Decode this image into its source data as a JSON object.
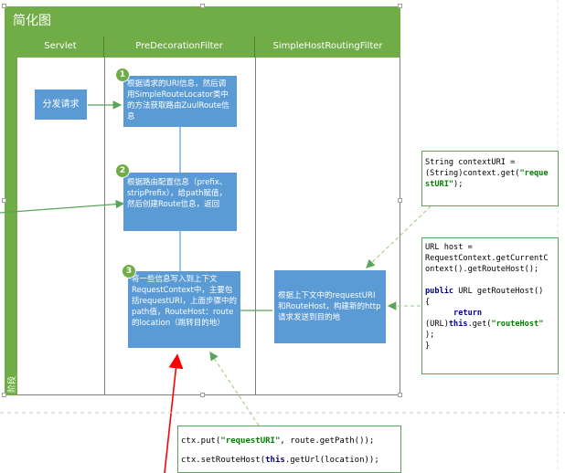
{
  "diagram": {
    "title": "简化图",
    "side_label": "阶段",
    "lanes": [
      "Servlet",
      "PreDecorationFilter",
      "SimpleHostRoutingFilter"
    ],
    "servlet_box": "分发请求",
    "steps": [
      {
        "number": "1",
        "text": "根据请求的URI信息，然后调用SimpleRouteLocator类中的方法获取路由ZuulRoute信息"
      },
      {
        "number": "2",
        "text": "根据路由配置信息（prefix、stripPrefix），给path赋值，然后创建Route信息，返回"
      },
      {
        "number": "3",
        "text": "将一些信息写入到上下文RequestContext中，主要包括requestURI，上面步骤中的path值，RouteHost：route的location（跳转目的地）"
      }
    ],
    "routing_box": "根据上下文中的requestURI和RouteHost，构建新的http请求发送到目的地",
    "code_context_uri": {
      "line1": "String contextURI =",
      "line2_prefix": "(String)context.get(",
      "line2_str": "\"reque",
      "line3_str": "stURI\"",
      "line3_suffix": ");"
    },
    "code_route_host": {
      "l1": "URL host =",
      "l2": "RequestContext.getCurrentC",
      "l3": "ontext().getRouteHost();",
      "l5_kw": "public",
      "l5_rest": " URL getRouteHost()",
      "l6": "{",
      "l7_kw": "return",
      "l8_prefix": "(URL)",
      "l8_kw": "this",
      "l8_mid": ".get(",
      "l8_str": "\"routeHost\"",
      "l9": ");",
      "l10": "}"
    },
    "code_ctx_put": {
      "l1_prefix": "ctx.put(",
      "l1_str": "\"requestURI\"",
      "l1_suffix": ", route.getPath());",
      "l2_prefix": "ctx.setRouteHost(",
      "l2_kw": "this",
      "l2_suffix": ".getUrl(location));"
    }
  }
}
